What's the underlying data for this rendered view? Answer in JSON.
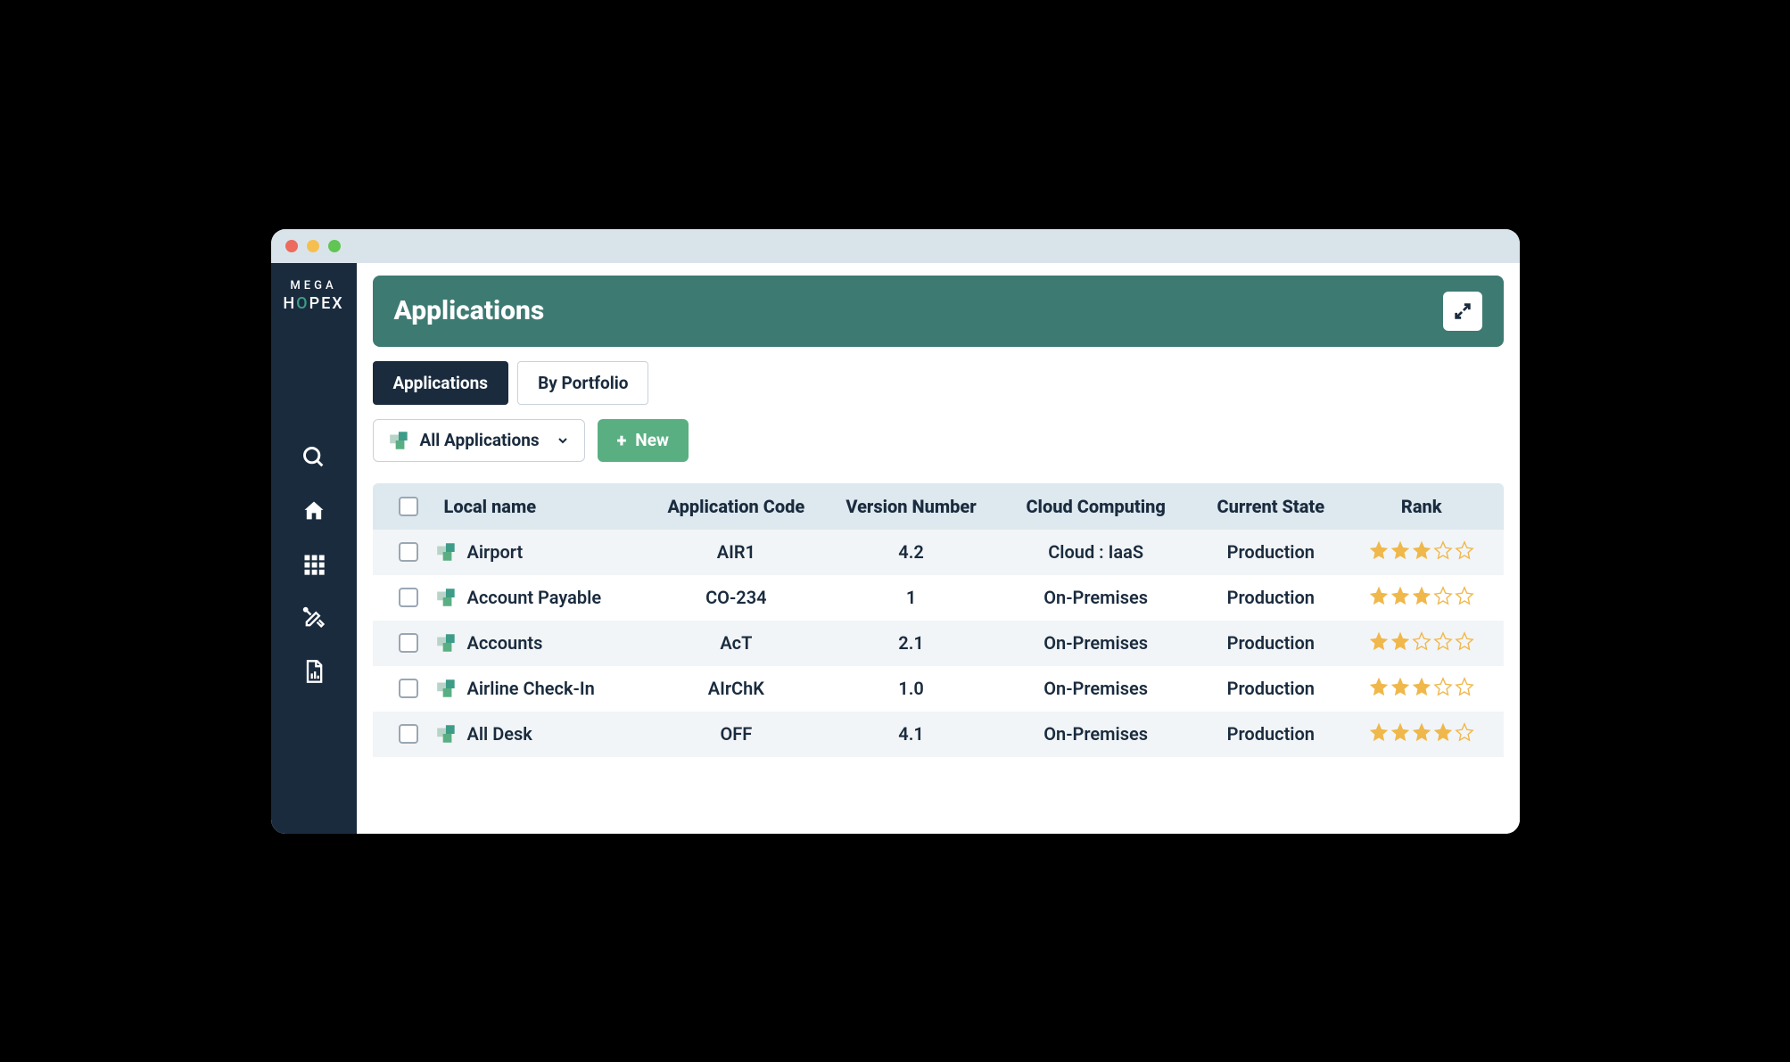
{
  "logo": {
    "line1": "MEGA",
    "line2_pre": "H",
    "line2_o": "O",
    "line2_post": "PEX"
  },
  "header": {
    "title": "Applications"
  },
  "tabs": [
    {
      "label": "Applications",
      "active": true
    },
    {
      "label": "By Portfolio",
      "active": false
    }
  ],
  "filter": {
    "label": "All Applications"
  },
  "new_button": {
    "label": "New"
  },
  "columns": [
    "Local name",
    "Application Code",
    "Version Number",
    "Cloud Computing",
    "Current State",
    "Rank"
  ],
  "rows": [
    {
      "name": "Airport",
      "code": "AIR1",
      "version": "4.2",
      "cloud": "Cloud : IaaS",
      "state": "Production",
      "rank": 3
    },
    {
      "name": "Account Payable",
      "code": "CO-234",
      "version": "1",
      "cloud": "On-Premises",
      "state": "Production",
      "rank": 3
    },
    {
      "name": "Accounts",
      "code": "AcT",
      "version": "2.1",
      "cloud": "On-Premises",
      "state": "Production",
      "rank": 2
    },
    {
      "name": "Airline Check-In",
      "code": "AIrChK",
      "version": "1.0",
      "cloud": "On-Premises",
      "state": "Production",
      "rank": 3
    },
    {
      "name": "All Desk",
      "code": "OFF",
      "version": "4.1",
      "cloud": "On-Premises",
      "state": "Production",
      "rank": 4
    }
  ]
}
